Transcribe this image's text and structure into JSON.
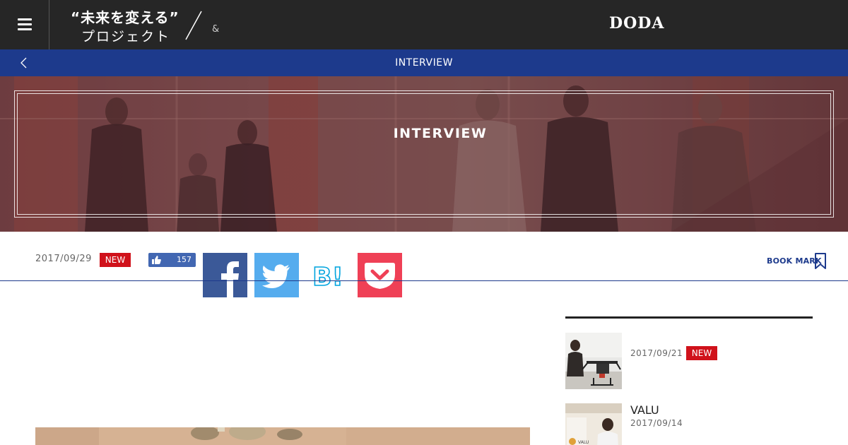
{
  "header": {
    "logo_line1": "“未来を変える”",
    "logo_line2": "プロジェクト",
    "ampersand": "&",
    "brand": "DODA",
    "menu_icon": "hamburger-icon"
  },
  "nav": {
    "title": "INTERVIEW",
    "back_icon": "chevron-left-icon"
  },
  "hero": {
    "title": "INTERVIEW"
  },
  "article_meta": {
    "date": "2017/09/29",
    "badge": "NEW",
    "like_count": "157",
    "share_buttons": [
      "facebook-icon",
      "twitter-icon",
      "hatena-bookmark-icon",
      "pocket-icon"
    ],
    "bookmark_label": "BOOK MARK"
  },
  "sidebar": {
    "items": [
      {
        "title": "",
        "date": "2017/09/21",
        "badge": "NEW"
      },
      {
        "title": "VALU",
        "date": "2017/09/14",
        "badge": ""
      }
    ]
  },
  "colors": {
    "topbar": "#262626",
    "nav_blue": "#1d3a8c",
    "badge_red": "#d0121b",
    "facebook": "#3b5998",
    "twitter": "#55acee",
    "hatena": "#00a4de",
    "pocket": "#ef4056"
  }
}
